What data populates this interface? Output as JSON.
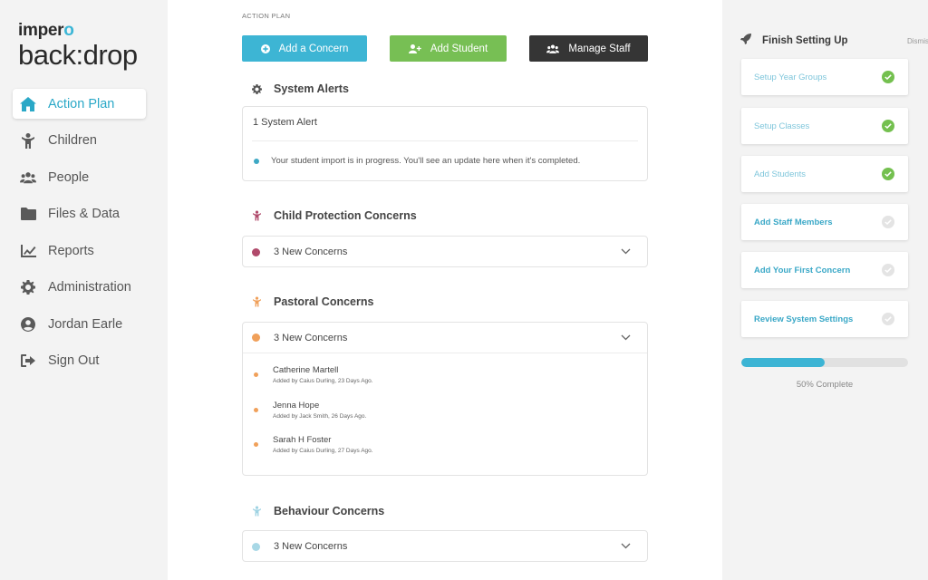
{
  "brand": {
    "top_pre": "imper",
    "top_o": "o",
    "bottom": "back:drop"
  },
  "sidebar": {
    "items": [
      {
        "label": "Action Plan",
        "icon": "home-icon",
        "active": true
      },
      {
        "label": "Children",
        "icon": "child-icon"
      },
      {
        "label": "People",
        "icon": "people-icon"
      },
      {
        "label": "Files & Data",
        "icon": "folder-icon"
      },
      {
        "label": "Reports",
        "icon": "chart-icon"
      },
      {
        "label": "Administration",
        "icon": "gear-icon"
      },
      {
        "label": "Jordan Earle",
        "icon": "user-icon"
      },
      {
        "label": "Sign Out",
        "icon": "sign-out-icon"
      }
    ]
  },
  "main": {
    "breadcrumb": "ACTION PLAN",
    "buttons": {
      "add_concern": "Add a Concern",
      "add_student": "Add Student",
      "manage_staff": "Manage Staff"
    },
    "system_alerts": {
      "title": "System Alerts",
      "count": "1 System Alert",
      "message": "Your student import is in progress. You'll see an update here when it's completed."
    },
    "child_protection": {
      "title": "Child Protection Concerns",
      "summary": "3 New Concerns",
      "color": "#b04a6b"
    },
    "pastoral": {
      "title": "Pastoral Concerns",
      "summary": "3 New Concerns",
      "color": "#f0a05a",
      "items": [
        {
          "name": "Catherine Martell",
          "meta": "Added by Caius Durling, 23 Days Ago."
        },
        {
          "name": "Jenna Hope",
          "meta": "Added by Jack Smith, 26 Days Ago."
        },
        {
          "name": "Sarah H Foster",
          "meta": "Added by Caius Durling, 27 Days Ago."
        }
      ]
    },
    "behaviour": {
      "title": "Behaviour Concerns",
      "summary": "3 New Concerns",
      "color": "#a8d8e6"
    }
  },
  "setup": {
    "title": "Finish Setting Up",
    "dismiss": "Dismiss",
    "steps": [
      {
        "label": "Setup Year Groups",
        "done": true
      },
      {
        "label": "Setup Classes",
        "done": true
      },
      {
        "label": "Add Students",
        "done": true
      },
      {
        "label": "Add Staff Members",
        "done": false
      },
      {
        "label": "Add Your First Concern",
        "done": false
      },
      {
        "label": "Review System Settings",
        "done": false
      }
    ],
    "progress_percent": 50,
    "progress_label": "50% Complete"
  }
}
